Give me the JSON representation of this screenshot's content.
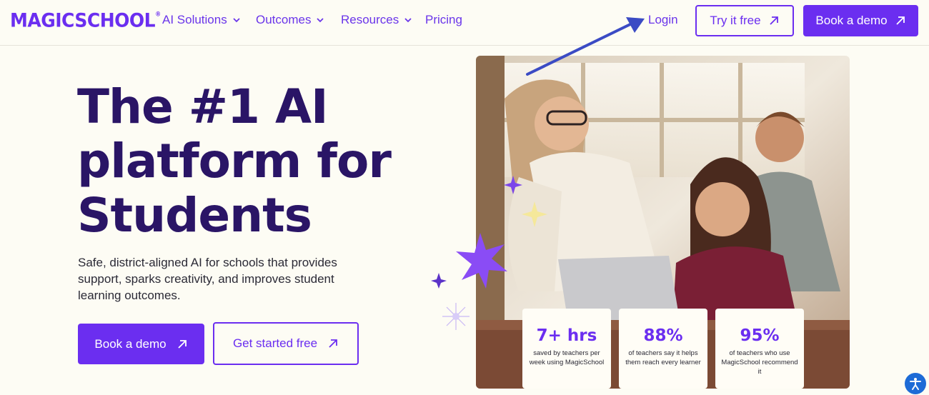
{
  "nav": {
    "logo": "MAGICSCHOOL",
    "logo_mark": "®",
    "items": [
      {
        "label": "AI Solutions",
        "has_dropdown": true
      },
      {
        "label": "Outcomes",
        "has_dropdown": true
      },
      {
        "label": "Resources",
        "has_dropdown": true
      },
      {
        "label": "Pricing",
        "has_dropdown": false
      }
    ],
    "login": "Login",
    "try_free": "Try it free",
    "book_demo": "Book a demo"
  },
  "hero": {
    "headline_lines": [
      "The #1 AI",
      "platform for",
      "Students"
    ],
    "subtext": "Safe, district-aligned AI for schools that provides support, sparks creativity, and improves student learning outcomes.",
    "cta_primary": "Book a demo",
    "cta_secondary": "Get started free"
  },
  "stats": [
    {
      "value": "7+ hrs",
      "desc": "saved by teachers per week using MagicSchool"
    },
    {
      "value": "88%",
      "desc": "of teachers say it helps them reach every learner"
    },
    {
      "value": "95%",
      "desc": "of teachers who use MagicSchool recommend it"
    }
  ],
  "icons": {
    "arrow": "arrow-up-right-icon",
    "chevron": "chevron-down-icon",
    "accessibility": "accessibility-icon"
  },
  "colors": {
    "brand": "#6b2ef0",
    "headline": "#2a1566",
    "background": "#fdfcf4",
    "annotation": "#3b4bc4"
  }
}
